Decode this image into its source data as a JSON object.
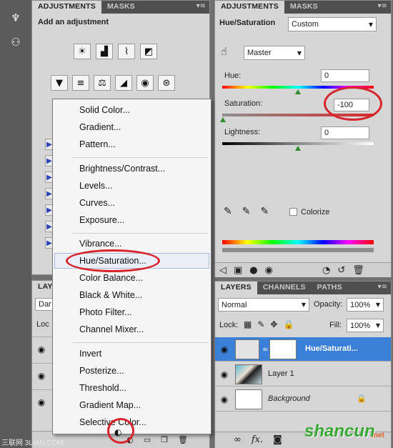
{
  "left_panel": {
    "tabs": [
      "ADJUSTMENTS",
      "MASKS"
    ],
    "heading": "Add an adjustment",
    "tab_menu_glyph": "▾≡"
  },
  "layers_left": {
    "tab_partial": "LAY",
    "blend_partial": "Dar",
    "lock_partial": "Loc"
  },
  "context_menu": {
    "group1": [
      "Solid Color...",
      "Gradient...",
      "Pattern..."
    ],
    "group2": [
      "Brightness/Contrast...",
      "Levels...",
      "Curves...",
      "Exposure..."
    ],
    "group3": [
      "Vibrance...",
      "Hue/Saturation...",
      "Color Balance...",
      "Black & White...",
      "Photo Filter...",
      "Channel Mixer..."
    ],
    "group4": [
      "Invert",
      "Posterize...",
      "Threshold...",
      "Gradient Map...",
      "Selective Color..."
    ]
  },
  "right_panel": {
    "tabs": [
      "ADJUSTMENTS",
      "MASKS"
    ],
    "title": "Hue/Saturation",
    "preset": "Custom",
    "range": "Master",
    "hue_label": "Hue:",
    "hue_value": "0",
    "saturation_label": "Saturation:",
    "saturation_value": "-100",
    "lightness_label": "Lightness:",
    "lightness_value": "0",
    "colorize_label": "Colorize"
  },
  "layers_right": {
    "tabs": [
      "LAYERS",
      "CHANNELS",
      "PATHS"
    ],
    "blend_mode": "Normal",
    "opacity_label": "Opacity:",
    "opacity_value": "100%",
    "lock_label": "Lock:",
    "fill_label": "Fill:",
    "fill_value": "100%",
    "layers": [
      {
        "name": "Hue/Saturati...",
        "selected": true
      },
      {
        "name": "Layer 1",
        "selected": false
      },
      {
        "name": "Background",
        "selected": false
      }
    ]
  },
  "watermarks": {
    "left_text": "三联网 3LIAN.COM",
    "right_text": "shancun",
    "right_suffix": ".net"
  },
  "colors": {
    "highlight_ring": "#d9232a",
    "selected_layer": "#3a7fd8",
    "panel_bg": "#d6d6d6"
  }
}
